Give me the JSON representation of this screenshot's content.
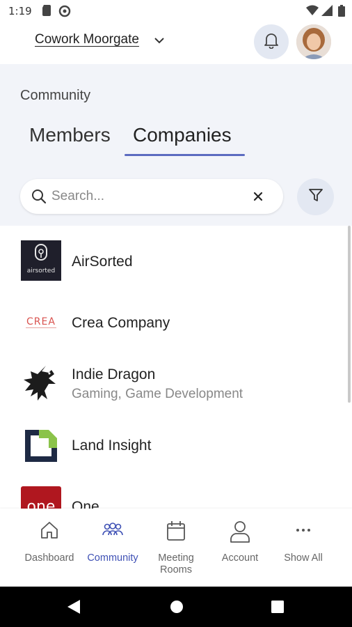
{
  "status_bar": {
    "time": "1:19"
  },
  "header": {
    "location": "Cowork Moorgate"
  },
  "community": {
    "title": "Community",
    "tabs": [
      {
        "label": "Members"
      },
      {
        "label": "Companies"
      }
    ],
    "active_tab": "Companies",
    "search": {
      "placeholder": "Search...",
      "value": ""
    }
  },
  "companies": [
    {
      "name": "AirSorted",
      "subtitle": "",
      "logo_text": "airsorted"
    },
    {
      "name": "Crea Company",
      "subtitle": "",
      "logo_text": "CREA"
    },
    {
      "name": "Indie Dragon",
      "subtitle": "Gaming, Game Development",
      "logo_text": ""
    },
    {
      "name": "Land Insight",
      "subtitle": "",
      "logo_text": ""
    },
    {
      "name": "One",
      "subtitle": "",
      "logo_text": "one"
    }
  ],
  "bottom_nav": [
    {
      "label": "Dashboard",
      "icon": "home-icon"
    },
    {
      "label": "Community",
      "icon": "people-icon"
    },
    {
      "label": "Meeting Rooms",
      "icon": "calendar-icon"
    },
    {
      "label": "Account",
      "icon": "person-icon"
    },
    {
      "label": "Show All",
      "icon": "more-icon"
    }
  ],
  "colors": {
    "accent": "#3f51b5",
    "tab_indicator": "#5c6bc0",
    "band_bg": "#f2f4f9",
    "icon_button_bg": "#e3e8f2"
  }
}
